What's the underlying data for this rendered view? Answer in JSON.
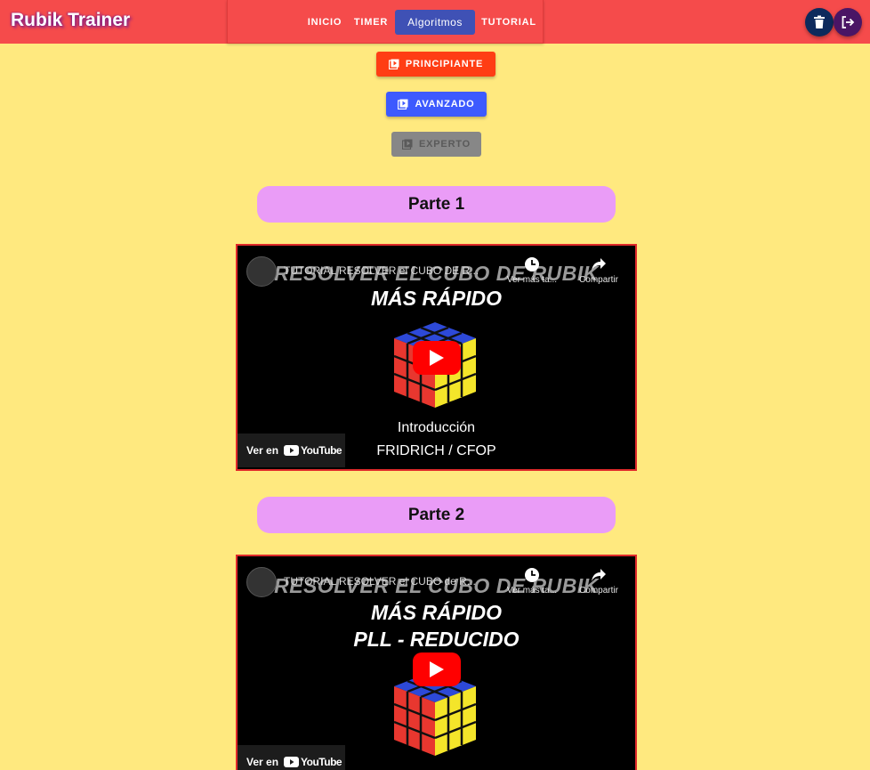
{
  "app": {
    "brand": "Rubik Trainer"
  },
  "nav": {
    "items": [
      {
        "label": "INICIO"
      },
      {
        "label": "TIMER"
      },
      {
        "label": "Algoritmos"
      },
      {
        "label": "TUTORIAL"
      }
    ]
  },
  "actions": {
    "delete_icon": "trash-icon",
    "logout_icon": "logout-icon"
  },
  "levels": {
    "beginner": "PRINCIPIANTE",
    "advanced": "AVANZADO",
    "expert": "EXPERTO"
  },
  "sections": [
    {
      "heading": "Parte 1",
      "video": {
        "title": "TUTORIAL RESOLVER el CUBO DE R...",
        "thumb_line1": "RESOLVER EL CUBO DE RUBIK",
        "thumb_line2": "MÁS RÁPIDO",
        "thumb_line3": "",
        "thumb_sub1": "Introducción",
        "thumb_sub2": "FRIDRICH / CFOP",
        "watch_later": "Ver más ta...",
        "share": "Compartir",
        "watch_on": "Ver en",
        "platform": "YouTube"
      }
    },
    {
      "heading": "Parte 2",
      "video": {
        "title": "TUTORIAL RESOLVER el CUBO de R...",
        "thumb_line1": "RESOLVER EL CUBO DE RUBIK",
        "thumb_line2": "MÁS RÁPIDO",
        "thumb_line3": "PLL - REDUCIDO",
        "watch_later": "Ver más ta...",
        "share": "Compartir",
        "watch_on": "Ver en",
        "platform": "YouTube"
      }
    }
  ],
  "colors": {
    "background": "#ffe97f",
    "topbar": "#f54b4b",
    "nav_active": "#3f51b5",
    "beginner_btn": "#ff3d14",
    "advanced_btn": "#3d5afe",
    "expert_btn": "#888888",
    "section_heading": "#ea9cf7",
    "delete_btn": "#0d2a5c",
    "logout_btn": "#4a1565"
  }
}
